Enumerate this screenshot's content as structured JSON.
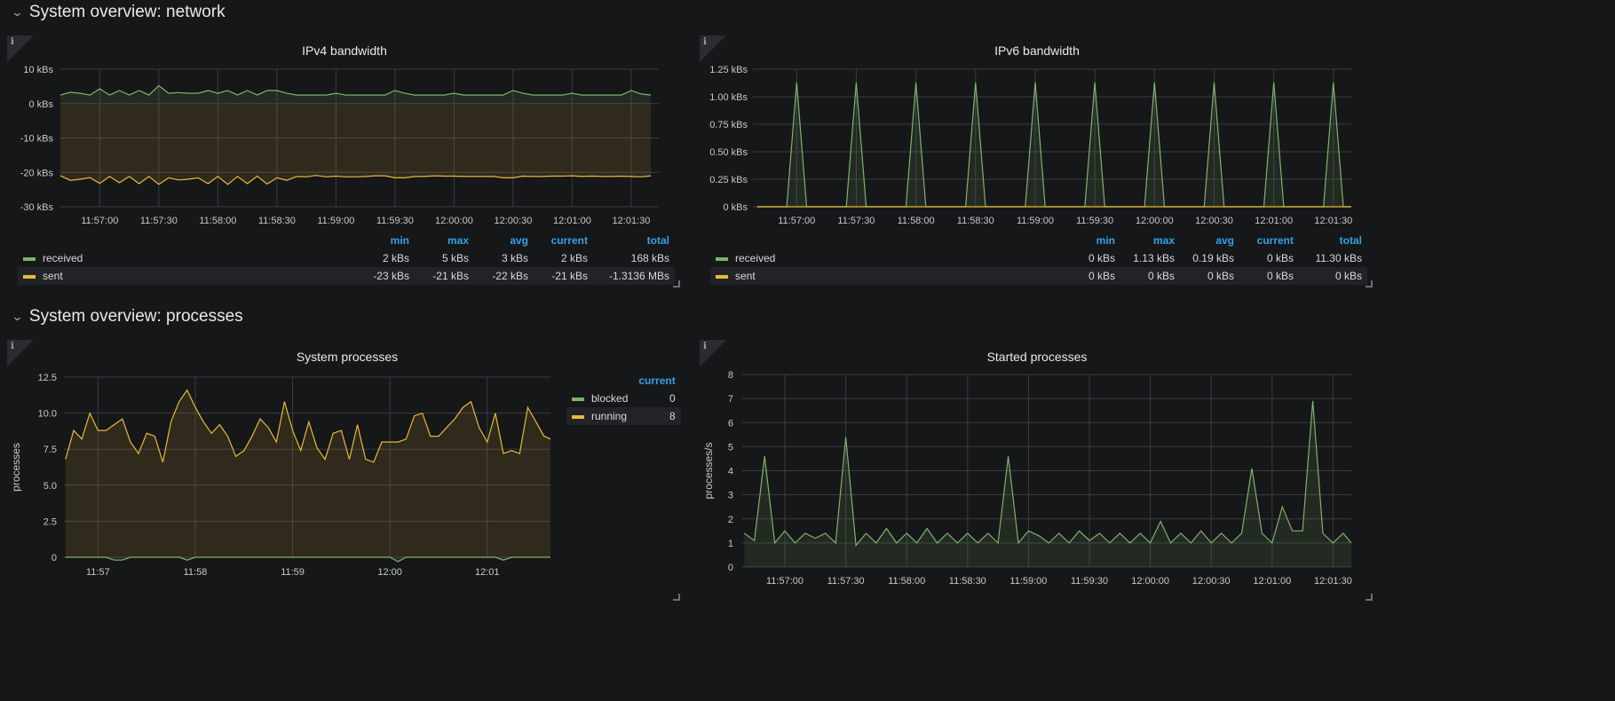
{
  "rows": [
    {
      "title": "System overview: network"
    },
    {
      "title": "System overview: processes"
    }
  ],
  "colors": {
    "received": "#7eb26d",
    "sent": "#eab839",
    "blocked": "#7eb26d",
    "running": "#eab839",
    "legend_header": "#33a2e5"
  },
  "panels": [
    {
      "title": "IPv4 bandwidth",
      "info_icon": "i",
      "legend": {
        "headers": [
          "min",
          "max",
          "avg",
          "current",
          "total"
        ],
        "rows": [
          {
            "name": "received",
            "values": [
              "2 kBs",
              "5 kBs",
              "3 kBs",
              "2 kBs",
              "168 kBs"
            ]
          },
          {
            "name": "sent",
            "values": [
              "-23 kBs",
              "-21 kBs",
              "-22 kBs",
              "-21 kBs",
              "-1.3136 MBs"
            ]
          }
        ]
      }
    },
    {
      "title": "IPv6 bandwidth",
      "info_icon": "i",
      "legend": {
        "headers": [
          "min",
          "max",
          "avg",
          "current",
          "total"
        ],
        "rows": [
          {
            "name": "received",
            "values": [
              "0 kBs",
              "1.13 kBs",
              "0.19 kBs",
              "0 kBs",
              "11.30 kBs"
            ]
          },
          {
            "name": "sent",
            "values": [
              "0 kBs",
              "0 kBs",
              "0 kBs",
              "0 kBs",
              "0 kBs"
            ]
          }
        ]
      }
    },
    {
      "title": "System processes",
      "info_icon": "i",
      "legend": {
        "headers": [
          "current"
        ],
        "rows": [
          {
            "name": "blocked",
            "values": [
              "0"
            ]
          },
          {
            "name": "running",
            "values": [
              "8"
            ]
          }
        ]
      }
    },
    {
      "title": "Started processes",
      "info_icon": "i"
    }
  ],
  "chart_data": [
    {
      "type": "area",
      "title": "IPv4 bandwidth",
      "x_start": "11:56:40",
      "step_seconds": 5,
      "xlim": [
        "11:56:40",
        "12:01:44"
      ],
      "ylim": [
        -30,
        10
      ],
      "yticks": [
        10,
        0,
        -10,
        -20,
        -30
      ],
      "ytick_labels": [
        "10 kBs",
        "0 kBs",
        "-10 kBs",
        "-20 kBs",
        "-30 kBs"
      ],
      "xticks": [
        "11:57:00",
        "11:57:30",
        "11:58:00",
        "11:58:30",
        "11:59:00",
        "11:59:30",
        "12:00:00",
        "12:00:30",
        "12:01:00",
        "12:01:30"
      ],
      "xlabel": "",
      "ylabel": "",
      "series": [
        {
          "name": "received",
          "color": "#7eb26d",
          "values": [
            2.5,
            3.3,
            3,
            2.5,
            4.3,
            2.5,
            3.8,
            2.5,
            3.8,
            2.5,
            5.2,
            3,
            3.2,
            3,
            3,
            3.8,
            3,
            3.8,
            2.5,
            3.8,
            2.5,
            3.8,
            3.8,
            3,
            2.5,
            2.5,
            2.5,
            2.5,
            3,
            2.5,
            2.5,
            2.5,
            2.5,
            2.5,
            3.8,
            3,
            2.5,
            2.5,
            2.5,
            2.5,
            3,
            2.5,
            2.5,
            2.5,
            2.5,
            2.5,
            3.8,
            3,
            2.5,
            2.5,
            2.5,
            2.5,
            3,
            2.5,
            2.5,
            2.5,
            2.5,
            2.5,
            3.8,
            2.8,
            2.5
          ]
        },
        {
          "name": "sent",
          "color": "#eab839",
          "values": [
            -21,
            -22.3,
            -22,
            -21.5,
            -23.2,
            -21.2,
            -23,
            -21.2,
            -23.3,
            -21.2,
            -23.5,
            -21.6,
            -22.2,
            -22,
            -21.6,
            -23.3,
            -21.2,
            -23.5,
            -21.2,
            -23.3,
            -21.1,
            -23.4,
            -21.6,
            -22.3,
            -21.2,
            -21.3,
            -20.9,
            -21.3,
            -21.1,
            -21.3,
            -21.3,
            -21.2,
            -21,
            -21,
            -21.6,
            -21.6,
            -21.2,
            -21.2,
            -21,
            -21.1,
            -21.1,
            -21.2,
            -21.2,
            -21.2,
            -21.2,
            -21.6,
            -21.6,
            -21.1,
            -21.2,
            -21.2,
            -21.1,
            -21.1,
            -21,
            -21.2,
            -21.1,
            -21.2,
            -21.2,
            -21.1,
            -21.2,
            -21.3,
            -21
          ]
        }
      ]
    },
    {
      "type": "area",
      "title": "IPv6 bandwidth",
      "x_start": "11:56:40",
      "step_seconds": 5,
      "xlim": [
        "11:56:38",
        "12:01:39"
      ],
      "ylim": [
        0,
        1.25
      ],
      "yticks": [
        1.25,
        1,
        0.75,
        0.5,
        0.25,
        0
      ],
      "ytick_labels": [
        "1.25 kBs",
        "1.00 kBs",
        "0.75 kBs",
        "0.50 kBs",
        "0.25 kBs",
        "0 kBs"
      ],
      "xticks": [
        "11:57:00",
        "11:57:30",
        "11:58:00",
        "11:58:30",
        "11:59:00",
        "11:59:30",
        "12:00:00",
        "12:00:30",
        "12:01:00",
        "12:01:30"
      ],
      "xlabel": "",
      "ylabel": "",
      "series": [
        {
          "name": "received",
          "color": "#7eb26d",
          "values": [
            0,
            0,
            0,
            0,
            1.13,
            0,
            0,
            0,
            0,
            0,
            1.13,
            0,
            0,
            0,
            0,
            0,
            1.13,
            0,
            0,
            0,
            0,
            0,
            1.13,
            0,
            0,
            0,
            0,
            0,
            1.13,
            0,
            0,
            0,
            0,
            0,
            1.13,
            0,
            0,
            0,
            0,
            0,
            1.13,
            0,
            0,
            0,
            0,
            0,
            1.13,
            0,
            0,
            0,
            0,
            0,
            1.13,
            0,
            0,
            0,
            0,
            0,
            1.13,
            0,
            0
          ]
        },
        {
          "name": "sent",
          "color": "#eab839",
          "values": [
            0,
            0,
            0,
            0,
            0,
            0,
            0,
            0,
            0,
            0,
            0,
            0,
            0,
            0,
            0,
            0,
            0,
            0,
            0,
            0,
            0,
            0,
            0,
            0,
            0,
            0,
            0,
            0,
            0,
            0,
            0,
            0,
            0,
            0,
            0,
            0,
            0,
            0,
            0,
            0,
            0,
            0,
            0,
            0,
            0,
            0,
            0,
            0,
            0,
            0,
            0,
            0,
            0,
            0,
            0,
            0,
            0,
            0,
            0,
            0,
            0
          ]
        }
      ]
    },
    {
      "type": "area",
      "title": "System processes",
      "x_start": "11:56:40",
      "step_seconds": 5,
      "xlim": [
        "11:56:39",
        "12:01:39"
      ],
      "ylim": [
        0,
        12.5
      ],
      "yticks": [
        12.5,
        10,
        7.5,
        5,
        2.5,
        0
      ],
      "ytick_labels": [
        "12.5",
        "10.0",
        "7.5",
        "5.0",
        "2.5",
        "0"
      ],
      "xticks": [
        "11:57:00",
        "11:58:00",
        "11:59:00",
        "12:00:00",
        "12:01:00"
      ],
      "xtick_labels": [
        "11:57",
        "11:58",
        "11:59",
        "12:00",
        "12:01"
      ],
      "xlabel": "",
      "ylabel": "processes",
      "series": [
        {
          "name": "blocked",
          "color": "#7eb26d",
          "values": [
            0,
            0,
            0,
            0,
            0,
            0,
            -0.2,
            -0.2,
            0,
            0,
            0,
            0,
            0,
            0,
            0,
            -0.2,
            0,
            0,
            0,
            0,
            0,
            0,
            0,
            0,
            0,
            0,
            0,
            0,
            0,
            0,
            0,
            0,
            0,
            0,
            0,
            0,
            0,
            0,
            0,
            0,
            0,
            -0.3,
            0,
            0,
            0,
            0,
            0,
            0,
            0,
            0,
            0,
            0,
            0,
            0,
            -0.2,
            0,
            0,
            0,
            0,
            0,
            0
          ]
        },
        {
          "name": "running",
          "color": "#eab839",
          "values": [
            6.8,
            8.8,
            8.2,
            10,
            8.8,
            8.8,
            9.2,
            9.6,
            8,
            7.2,
            8.6,
            8.4,
            6.6,
            9.4,
            10.8,
            11.6,
            10.4,
            9.4,
            8.6,
            9.2,
            8.4,
            7,
            7.4,
            8.4,
            9.6,
            9,
            8,
            10.8,
            8.8,
            7.4,
            9.4,
            7.6,
            6.8,
            8.6,
            8.8,
            6.8,
            9.2,
            6.8,
            6.6,
            8,
            8,
            8,
            8.2,
            9.8,
            10,
            8.4,
            8.4,
            9,
            9.6,
            10.4,
            10.8,
            9,
            8,
            10,
            7.2,
            7.4,
            7.2,
            10.4,
            9.4,
            8.4,
            8.2
          ]
        }
      ]
    },
    {
      "type": "area",
      "title": "Started processes",
      "x_start": "11:56:40",
      "step_seconds": 5,
      "xlim": [
        "11:56:39",
        "12:01:39"
      ],
      "ylim": [
        0,
        8
      ],
      "yticks": [
        8,
        7,
        6,
        5,
        4,
        3,
        2,
        1,
        0
      ],
      "ytick_labels": [
        "8",
        "7",
        "6",
        "5",
        "4",
        "3",
        "2",
        "1",
        "0"
      ],
      "xticks": [
        "11:57:00",
        "11:57:30",
        "11:58:00",
        "11:58:30",
        "11:59:00",
        "11:59:30",
        "12:00:00",
        "12:00:30",
        "12:01:00",
        "12:01:30"
      ],
      "xlabel": "",
      "ylabel": "processes/s",
      "series": [
        {
          "name": "started",
          "color": "#7eb26d",
          "values": [
            1.4,
            1.1,
            4.6,
            1.0,
            1.5,
            1.0,
            1.4,
            1.2,
            1.4,
            1.0,
            5.4,
            0.9,
            1.4,
            1.0,
            1.6,
            1.0,
            1.4,
            1.0,
            1.6,
            1.0,
            1.4,
            1.0,
            1.4,
            1.0,
            1.4,
            1.0,
            4.6,
            1.0,
            1.5,
            1.3,
            1.0,
            1.4,
            1.0,
            1.5,
            1.1,
            1.4,
            1.0,
            1.4,
            1.0,
            1.4,
            1.0,
            1.9,
            1.0,
            1.4,
            1.0,
            1.5,
            1.0,
            1.4,
            1.0,
            1.4,
            4.1,
            1.4,
            1.0,
            2.5,
            1.5,
            1.5,
            6.9,
            1.4,
            1.0,
            1.4,
            1.0
          ]
        }
      ]
    }
  ]
}
